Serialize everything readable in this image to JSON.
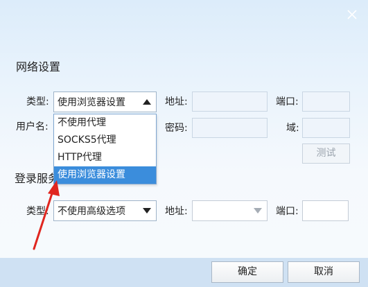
{
  "network": {
    "title": "网络设置",
    "type_label": "类型:",
    "type_value": "使用浏览器设置",
    "address_label": "地址:",
    "port_label": "端口:",
    "username_label": "用户名:",
    "password_label": "密码:",
    "domain_label": "域:",
    "test_button": "测试",
    "dropdown_options": [
      "不使用代理",
      "SOCKS5代理",
      "HTTP代理",
      "使用浏览器设置"
    ]
  },
  "login_server": {
    "title": "登录服务器",
    "type_label": "类型:",
    "type_value": "不使用高级选项",
    "address_label": "地址:",
    "port_label": "端口:"
  },
  "footer": {
    "ok_button": "确定",
    "cancel_button": "取消"
  },
  "colors": {
    "selected_option": "#3b8ddc",
    "annotation_arrow": "#e0261f"
  },
  "icons": {
    "close": "close-icon",
    "dropdown_up": "caret-up-icon",
    "dropdown_down": "caret-down-icon"
  }
}
